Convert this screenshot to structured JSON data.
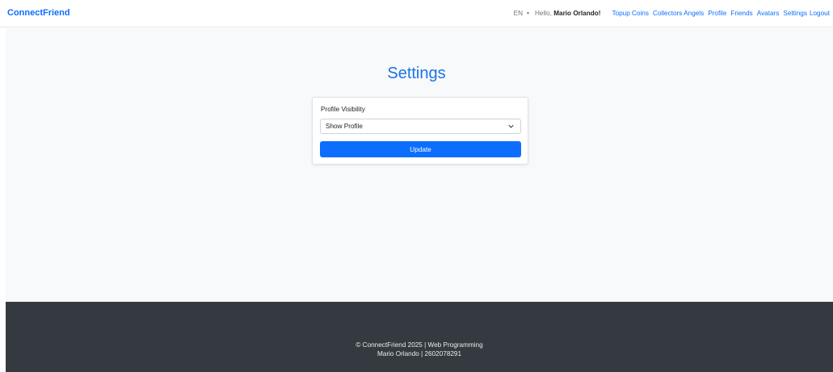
{
  "navbar": {
    "brand": "ConnectFriend",
    "language": "EN",
    "greeting_prefix": "Hello, ",
    "user_name": "Mario Orlando!",
    "links": [
      "Topup Coins",
      "Collectors Angels",
      "Profile",
      "Friends",
      "Avatars",
      "Settings",
      "Logout"
    ]
  },
  "page": {
    "title": "Settings"
  },
  "form": {
    "label": "Profile Visibility",
    "selected": "Show Profile",
    "button": "Update"
  },
  "footer": {
    "line1": "© ConnectFriend 2025 | Web Programming",
    "line2": "Mario Orlando | 2602078291"
  },
  "colors": {
    "accent": "#0d6efd",
    "footer_bg": "#343a40",
    "main_bg": "#f8f9fa"
  }
}
